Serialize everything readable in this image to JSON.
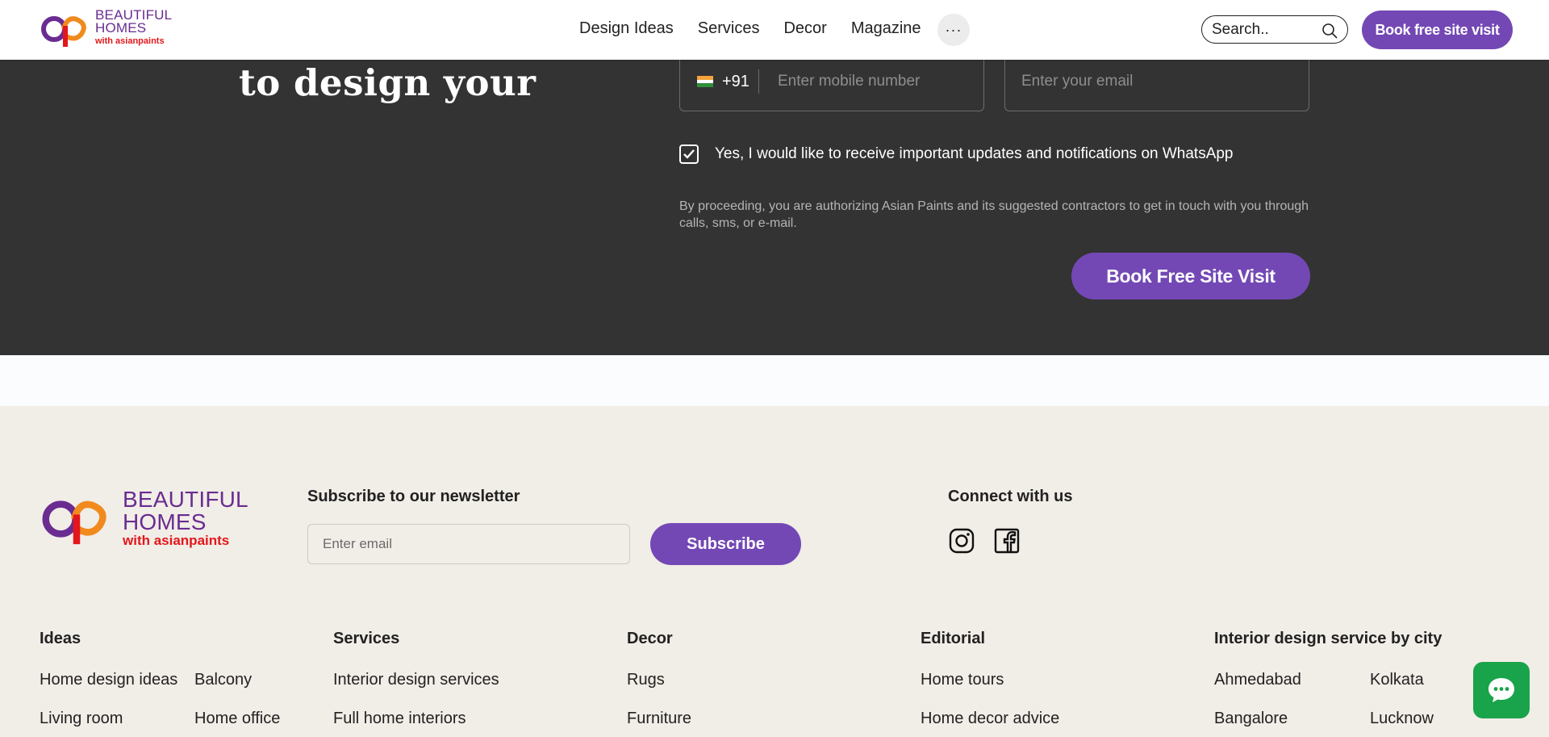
{
  "header": {
    "logo": {
      "line1": "BEAUTIFUL",
      "line2": "HOMES",
      "line3": "with asianpaints"
    },
    "nav": [
      "Design Ideas",
      "Services",
      "Decor",
      "Magazine"
    ],
    "more_icon": "···",
    "search_placeholder": "Search..",
    "book_button": "Book free site visit"
  },
  "form": {
    "heading": "to design your",
    "country_code": "+91",
    "mobile_placeholder": "Enter mobile number",
    "email_placeholder": "Enter your email",
    "whatsapp_consent": "Yes, I would like to receive important updates and notifications on WhatsApp",
    "whatsapp_checked": true,
    "disclaimer": "By proceeding, you are authorizing Asian Paints and its suggested contractors to get in touch with you through calls, sms, or e-mail.",
    "submit_button": "Book Free Site Visit"
  },
  "footer": {
    "logo": {
      "line1": "BEAUTIFUL",
      "line2": "HOMES",
      "line3": "with asianpaints"
    },
    "newsletter": {
      "title": "Subscribe to our newsletter",
      "placeholder": "Enter email",
      "button": "Subscribe"
    },
    "connect": {
      "title": "Connect with us",
      "icons": [
        "instagram-icon",
        "facebook-icon"
      ]
    },
    "columns": {
      "ideas": {
        "title": "Ideas",
        "links": [
          "Home design ideas",
          "Balcony",
          "Living room",
          "Home office"
        ]
      },
      "services": {
        "title": "Services",
        "links": [
          "Interior design services",
          "Full home interiors"
        ]
      },
      "decor": {
        "title": "Decor",
        "links": [
          "Rugs",
          "Furniture"
        ]
      },
      "editorial": {
        "title": "Editorial",
        "links": [
          "Home tours",
          "Home decor advice"
        ]
      },
      "cities": {
        "title": "Interior design service by city",
        "links": [
          "Ahmedabad",
          "Kolkata",
          "Bangalore",
          "Lucknow"
        ]
      }
    }
  },
  "colors": {
    "brand_purple": "#7348b5",
    "dark_section": "#333333",
    "footer_bg": "#f1ede7",
    "chat_green": "#19a34a"
  },
  "chat_icon": "chat-bubble-icon"
}
